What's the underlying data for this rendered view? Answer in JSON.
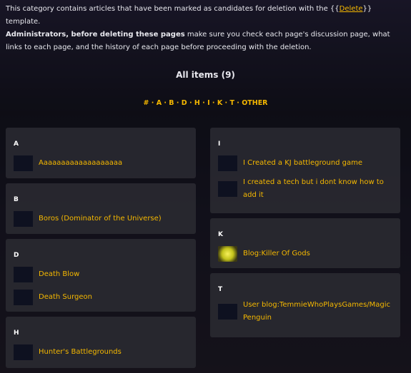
{
  "intro": {
    "line1_prefix": "This category contains articles that have been marked as candidates for deletion with the {{",
    "line1_link": "Delete",
    "line1_suffix": "}} template.",
    "line2_bold": "Administrators, before deleting these pages",
    "line2_rest": " make sure you check each page's discussion page, what links to each page, and the history of each page before proceeding with the deletion."
  },
  "all_items_label": "All items (9)",
  "letter_nav": [
    "#",
    "A",
    "B",
    "D",
    "H",
    "I",
    "K",
    "T",
    "OTHER"
  ],
  "left_groups": [
    {
      "letter": "A",
      "items": [
        {
          "title": "Aaaaaaaaaaaaaaaaaaa"
        }
      ]
    },
    {
      "letter": "B",
      "items": [
        {
          "title": "Boros (Dominator of the Universe)"
        }
      ]
    },
    {
      "letter": "D",
      "items": [
        {
          "title": "Death Blow"
        },
        {
          "title": "Death Surgeon"
        }
      ]
    },
    {
      "letter": "H",
      "items": [
        {
          "title": "Hunter's Battlegrounds"
        }
      ]
    }
  ],
  "right_groups": [
    {
      "letter": "I",
      "items": [
        {
          "title": "I Created a KJ battleground game"
        },
        {
          "title": "I created a tech but i dont know how to add it"
        }
      ]
    },
    {
      "letter": "K",
      "items": [
        {
          "title": "Blog:Killer Of Gods"
        }
      ]
    },
    {
      "letter": "T",
      "items": [
        {
          "title": "User blog:TemmieWhoPlaysGames/Magic Penguin"
        }
      ]
    }
  ],
  "colors": {
    "link": "#f5b800",
    "card_bg": "#28282f",
    "thumb_bg": "#0e1120"
  }
}
